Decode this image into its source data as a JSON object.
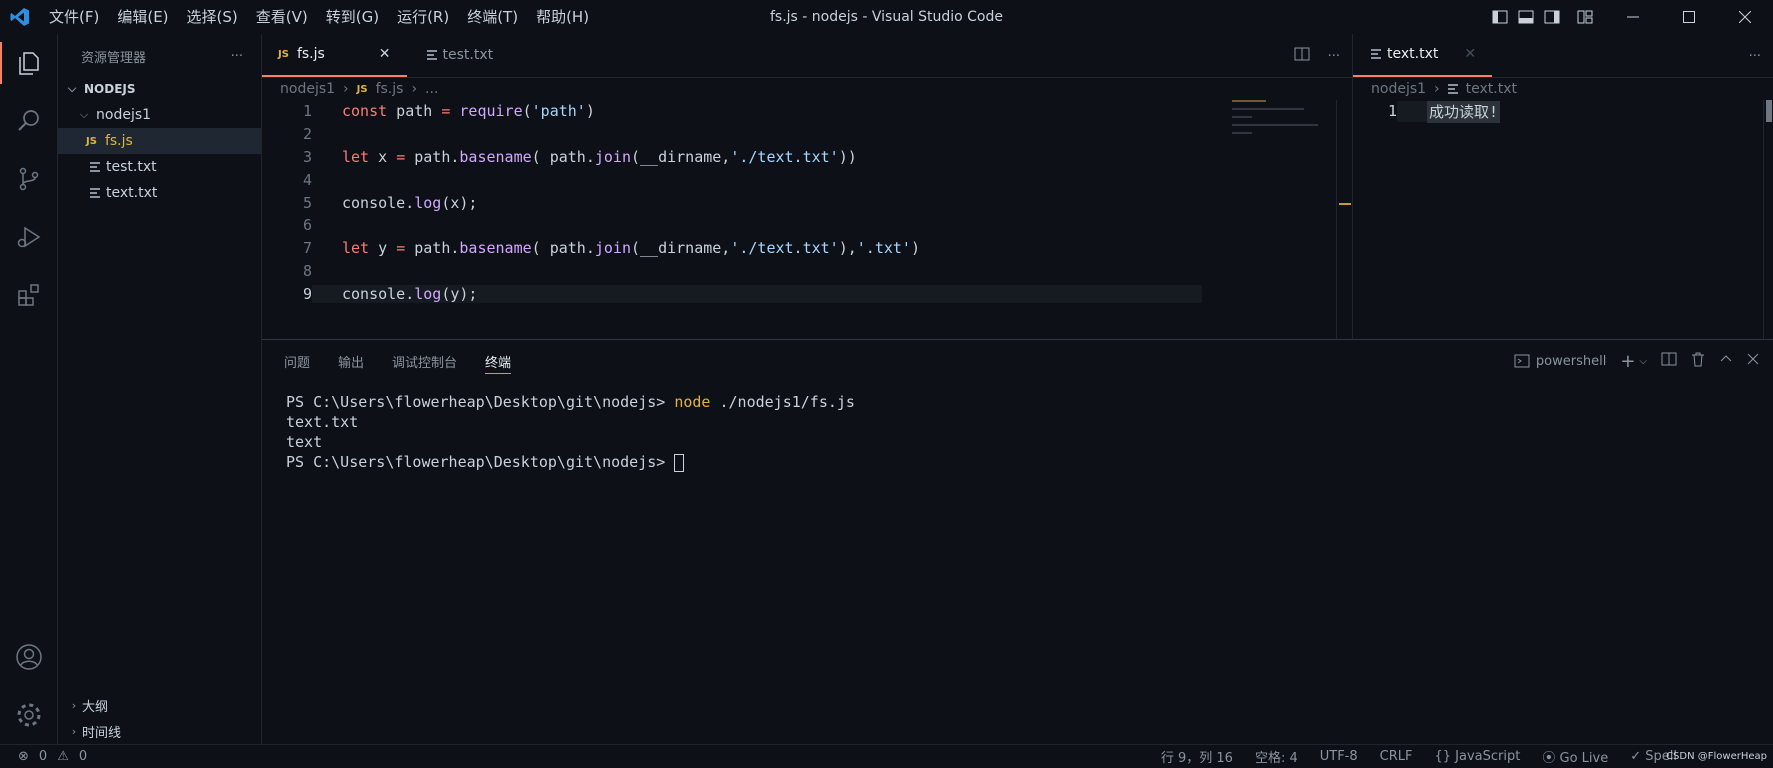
{
  "titlebar": {
    "title": "fs.js - nodejs - Visual Studio Code",
    "menu": [
      "文件(F)",
      "编辑(E)",
      "选择(S)",
      "查看(V)",
      "转到(G)",
      "运行(R)",
      "终端(T)",
      "帮助(H)"
    ]
  },
  "sidebar": {
    "header": "资源管理器",
    "more": "···",
    "root": "NODEJS",
    "folder": "nodejs1",
    "files": [
      "fs.js",
      "test.txt",
      "text.txt"
    ],
    "outline": "大纲",
    "timeline": "时间线"
  },
  "editor1": {
    "tabs": [
      {
        "label": "fs.js",
        "icon": "JS"
      },
      {
        "label": "test.txt"
      }
    ],
    "close": "✕",
    "breadcrumb": {
      "folder": "nodejs1",
      "icon": "JS",
      "file": "fs.js",
      "tail": "..."
    },
    "line_numbers": [
      "1",
      "2",
      "3",
      "4",
      "5",
      "6",
      "7",
      "8",
      "9"
    ]
  },
  "editor2": {
    "tab": "text.txt",
    "close": "✕",
    "breadcrumb": {
      "folder": "nodejs1",
      "file": "text.txt"
    },
    "line_number": "1",
    "content": "成功读取!"
  },
  "panel": {
    "tabs": [
      "问题",
      "输出",
      "调试控制台",
      "终端"
    ],
    "shell": "powershell",
    "terminal": {
      "prompt": "PS C:\\Users\\flowerheap\\Desktop\\git\\nodejs> ",
      "command": "node",
      "args": " ./nodejs1/fs.js",
      "output": [
        "text.txt",
        "text"
      ]
    }
  },
  "status": {
    "errors": "0",
    "warnings": "0",
    "position": "行 9，列 16",
    "spaces": "空格: 4",
    "encoding": "UTF-8",
    "eol": "CRLF",
    "language": "JavaScript",
    "golive": "Go Live",
    "spell": "Spell",
    "watermark": "CSDN @FlowerHeap"
  },
  "colors": {
    "accent": "#f78166",
    "keyword": "#ff7b72",
    "function": "#d2a8ff",
    "string": "#a5d6ff",
    "warning": "#d29922"
  }
}
